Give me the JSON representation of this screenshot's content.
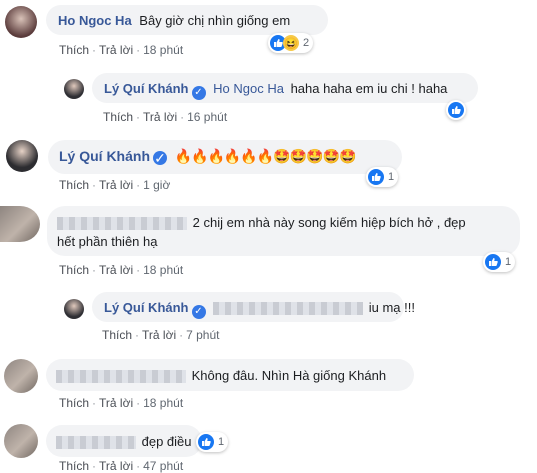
{
  "comments": [
    {
      "author": "Ho Ngoc Ha",
      "text": "Bây giờ chị nhìn giống em",
      "time": "18 phút",
      "reactions": "2",
      "icons": [
        "like-icon",
        "haha-icon"
      ]
    },
    {
      "author": "Lý Quí Khánh",
      "tag": "Ho Ngoc Ha",
      "text": "haha haha em iu chi ! haha",
      "time": "16 phút",
      "icons": [
        "like-icon"
      ]
    },
    {
      "author": "Lý Quí Khánh",
      "emojis": "🔥🔥🔥🔥🔥🔥🤩🤩🤩🤩🤩",
      "time": "1 giờ",
      "reactions": "1",
      "icons": [
        "like-icon"
      ]
    },
    {
      "author": "",
      "text_line1": "2 chij em nhà này song kiếm hiệp bích hở , đẹp",
      "text_line2": "hết phần thiên hạ",
      "time": "18 phút",
      "reactions": "1",
      "icons": [
        "like-icon"
      ]
    },
    {
      "author": "Lý Quí Khánh",
      "text": "iu mạ !!!",
      "time": "7 phút",
      "icons": [
        "like-icon"
      ]
    },
    {
      "author": "",
      "text": "Không đâu. Nhìn Hà giống Khánh",
      "time": "18 phút"
    },
    {
      "author": "",
      "text": "đẹp điều",
      "time": "47 phút",
      "reactions": "1",
      "icons": [
        "like-icon"
      ]
    }
  ],
  "labels": {
    "like": "Thích",
    "reply": "Trả lời"
  },
  "colors": {
    "name": "#385898",
    "like": "#1877f2",
    "bubble": "#f2f3f5"
  }
}
